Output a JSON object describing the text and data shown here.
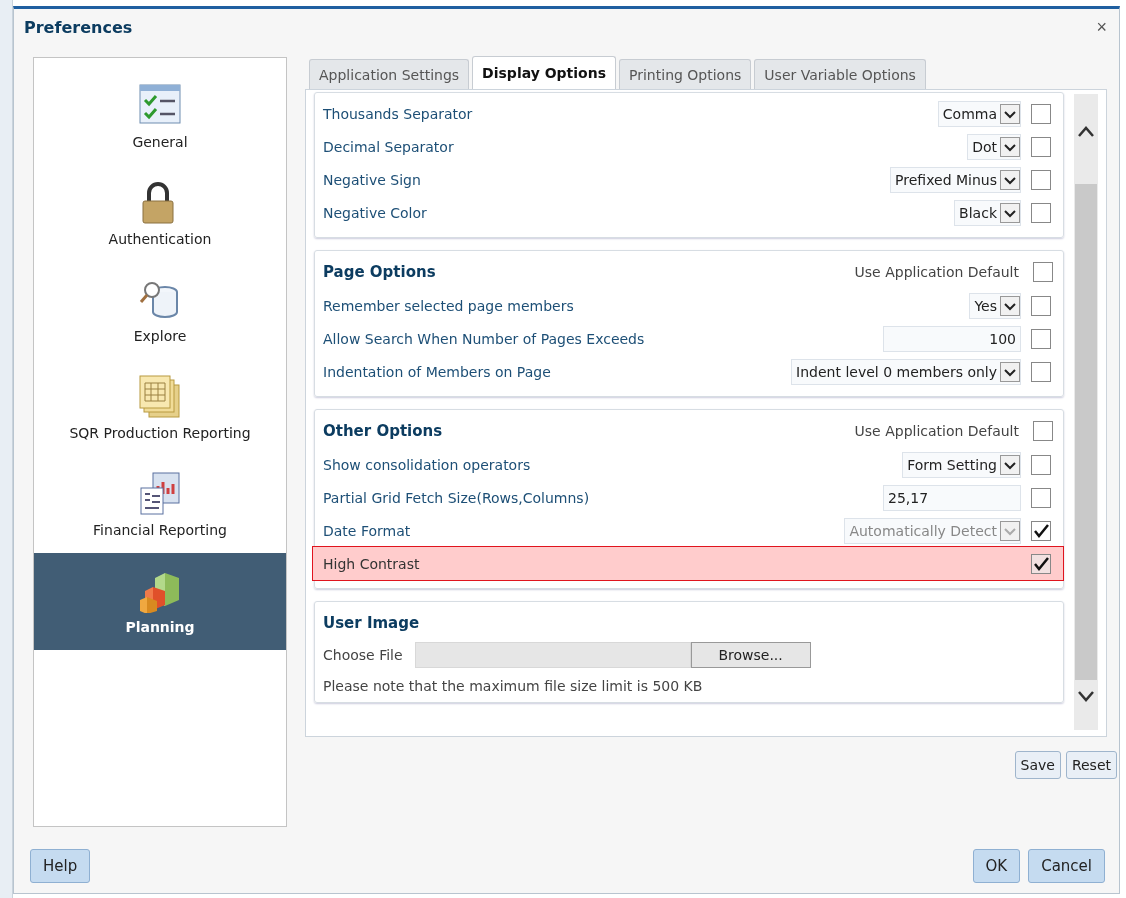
{
  "window": {
    "title": "Preferences",
    "close": "×"
  },
  "sidebar": {
    "items": [
      {
        "label": "General",
        "kind": "checklist",
        "selected": false
      },
      {
        "label": "Authentication",
        "kind": "lock",
        "selected": false
      },
      {
        "label": "Explore",
        "kind": "database",
        "selected": false
      },
      {
        "label": "SQR Production Reporting",
        "kind": "pages",
        "selected": false
      },
      {
        "label": "Financial Reporting",
        "kind": "report",
        "selected": false
      },
      {
        "label": "Planning",
        "kind": "cubes",
        "selected": true
      }
    ]
  },
  "tabs": [
    {
      "label": "Application Settings",
      "selected": false
    },
    {
      "label": "Display Options",
      "selected": true
    },
    {
      "label": "Printing Options",
      "selected": false
    },
    {
      "label": "User Variable Options",
      "selected": false
    }
  ],
  "sections": [
    {
      "rows": [
        {
          "kind": "select",
          "label": "Thousands Separator",
          "value": "Comma",
          "checked": false
        },
        {
          "kind": "select",
          "label": "Decimal Separator",
          "value": "Dot",
          "checked": false
        },
        {
          "kind": "select",
          "label": "Negative Sign",
          "value": "Prefixed Minus",
          "checked": false
        },
        {
          "kind": "select",
          "label": "Negative Color",
          "value": "Black",
          "checked": false
        }
      ]
    },
    {
      "title": "Page Options",
      "default_label": "Use Application Default",
      "default_checked": false,
      "rows": [
        {
          "kind": "select",
          "label": "Remember selected page members",
          "value": "Yes",
          "checked": false
        },
        {
          "kind": "number",
          "label": "Allow Search When Number of Pages Exceeds",
          "value": "100",
          "checked": false
        },
        {
          "kind": "select",
          "label": "Indentation of Members on Page",
          "value": "Indent level 0 members only",
          "checked": false
        }
      ]
    },
    {
      "title": "Other Options",
      "default_label": "Use Application Default",
      "default_checked": false,
      "rows": [
        {
          "kind": "select",
          "label": "Show consolidation operators",
          "value": "Form Setting",
          "checked": false
        },
        {
          "kind": "text",
          "label": "Partial Grid Fetch Size(Rows,Columns)",
          "value": "25,17",
          "checked": false
        },
        {
          "kind": "select",
          "label": "Date Format",
          "value": "Automatically Detect",
          "checked": true,
          "disabled": true
        },
        {
          "kind": "none",
          "label": "High Contrast",
          "checked": true,
          "highlighted": true
        }
      ]
    },
    {
      "title": "User Image",
      "file": {
        "label": "Choose File",
        "button": "Browse..."
      },
      "note": "Please note that the maximum file size limit is 500 KB"
    }
  ],
  "actions": [
    "Save",
    "Reset"
  ],
  "footer": {
    "left": [
      "Help"
    ],
    "right": [
      "OK",
      "Cancel"
    ]
  }
}
